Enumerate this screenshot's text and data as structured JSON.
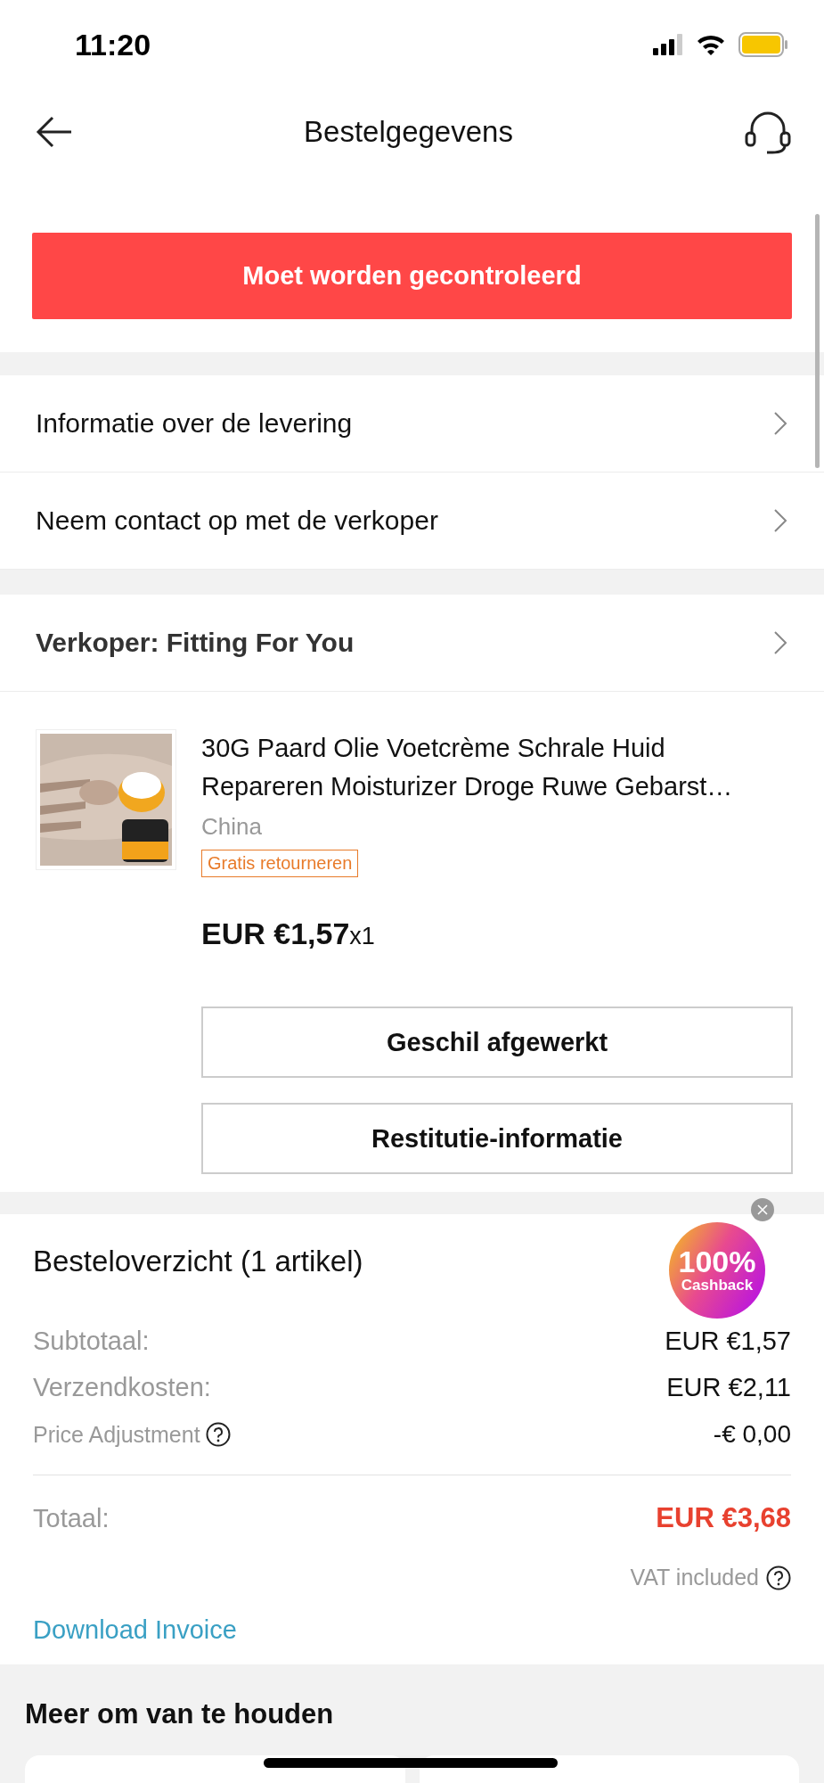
{
  "status_bar": {
    "time": "11:20"
  },
  "header": {
    "title": "Bestelgegevens"
  },
  "status_button": "Moet worden gecontroleerd",
  "links": [
    "Informatie over de levering",
    "Neem contact op met de verkoper"
  ],
  "seller": "Verkoper: Fitting For You",
  "product": {
    "kind": "picture",
    "title": "30G Paard Olie Voetcrème Schrale Huid Repareren Moisturizer Droge Ruwe Gebarst…",
    "origin": "China",
    "tag": "Gratis retourneren",
    "price": "EUR €1,57",
    "quantity": "x1",
    "buttons": [
      "Geschil afgewerkt",
      "Restitutie-informatie"
    ]
  },
  "summary": {
    "title": "Besteloverzicht (1 artikel)",
    "lines": [
      {
        "kind": "plain",
        "label": "Subtotaal:",
        "value": "EUR €1,57"
      },
      {
        "kind": "plain",
        "label": "Verzendkosten:",
        "value": "EUR €2,11"
      },
      {
        "kind": "help",
        "label": "Price Adjustment",
        "value": "-€ 0,00"
      }
    ],
    "total_label": "Totaal:",
    "total": "EUR €3,68",
    "vat": "VAT included",
    "download": "Download Invoice"
  },
  "promo": {
    "percent": "100%",
    "label": "Cashback"
  },
  "recommendations": {
    "title": "Meer om van te houden"
  }
}
